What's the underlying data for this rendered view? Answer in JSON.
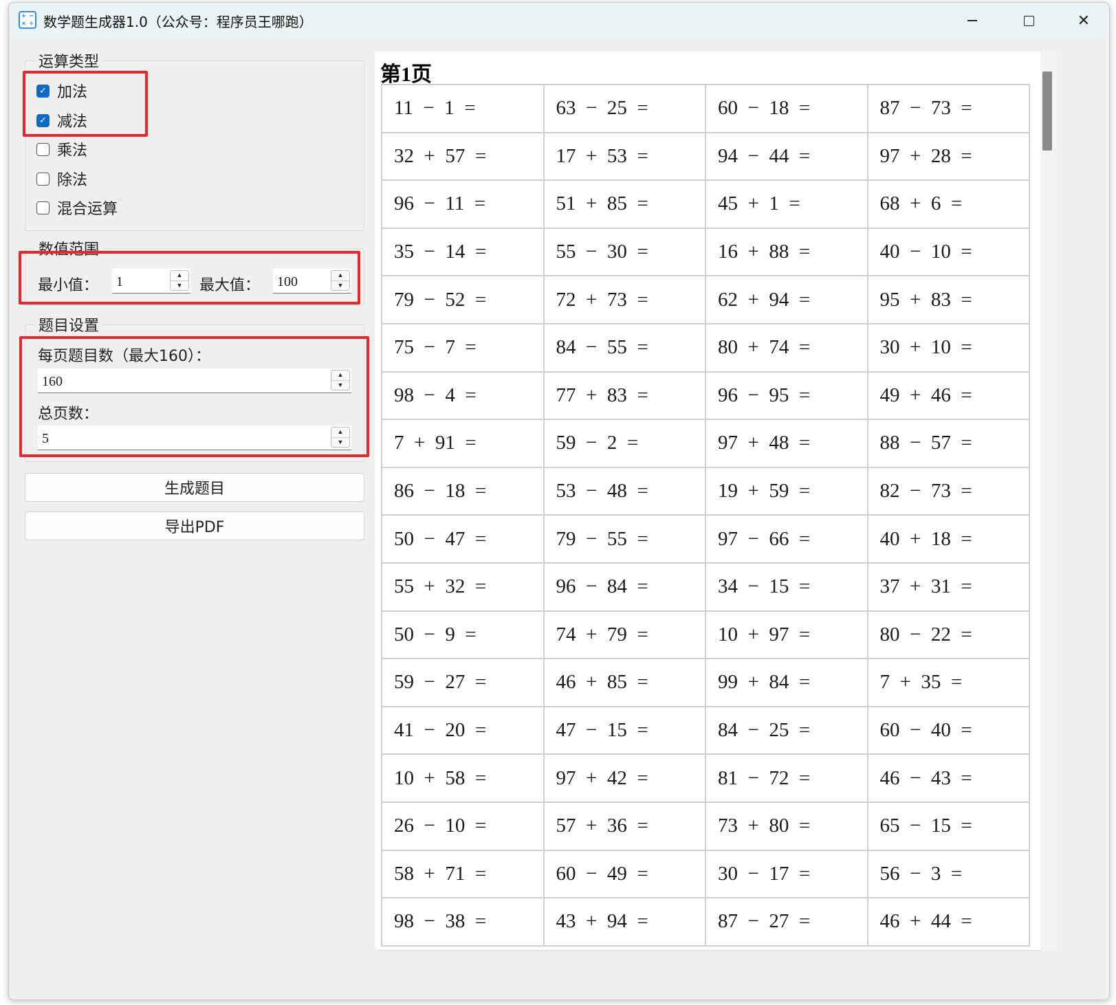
{
  "window": {
    "title": "数学题生成器1.0（公众号：程序员王哪跑）",
    "icon_glyphs": [
      "+",
      "−",
      "×",
      "÷"
    ],
    "minimize_icon": "minimize-icon",
    "maximize_icon": "maximize-icon",
    "close_icon": "close-icon",
    "close_glyph": "✕"
  },
  "operation_group": {
    "title": "运算类型",
    "options": [
      {
        "label": "加法",
        "checked": true
      },
      {
        "label": "减法",
        "checked": true
      },
      {
        "label": "乘法",
        "checked": false
      },
      {
        "label": "除法",
        "checked": false
      },
      {
        "label": "混合运算",
        "checked": false
      }
    ]
  },
  "range_group": {
    "title": "数值范围",
    "min_label": "最小值：",
    "min_value": "1",
    "max_label": "最大值：",
    "max_value": "100"
  },
  "settings_group": {
    "title": "题目设置",
    "per_page_label": "每页题目数（最大160）：",
    "per_page_value": "160",
    "total_pages_label": "总页数：",
    "total_pages_value": "5"
  },
  "buttons": {
    "generate": "生成题目",
    "export_pdf": "导出PDF"
  },
  "highlight_color": "#e8262b",
  "accent_color": "#0d6bc4",
  "preview": {
    "page_title": "第1页",
    "questions": [
      "11  −  1  =",
      "63  −  25  =",
      "60  −  18  =",
      "87  −  73  =",
      "32  +  57  =",
      "17  +  53  =",
      "94  −  44  =",
      "97  +  28  =",
      "96  −  11  =",
      "51  +  85  =",
      "45  +  1  =",
      "68  +  6  =",
      "35  −  14  =",
      "55  −  30  =",
      "16  +  88  =",
      "40  −  10  =",
      "79  −  52  =",
      "72  +  73  =",
      "62  +  94  =",
      "95  +  83  =",
      "75  −  7  =",
      "84  −  55  =",
      "80  +  74  =",
      "30  +  10  =",
      "98  −  4  =",
      "77  +  83  =",
      "96  −  95  =",
      "49  +  46  =",
      "7  +  91  =",
      "59  −  2  =",
      "97  +  48  =",
      "88  −  57  =",
      "86  −  18  =",
      "53  −  48  =",
      "19  +  59  =",
      "82  −  73  =",
      "50  −  47  =",
      "79  −  55  =",
      "97  −  66  =",
      "40  +  18  =",
      "55  +  32  =",
      "96  −  84  =",
      "34  −  15  =",
      "37  +  31  =",
      "50  −  9  =",
      "74  +  79  =",
      "10  +  97  =",
      "80  −  22  =",
      "59  −  27  =",
      "46  +  85  =",
      "99  +  84  =",
      "7  +  35  =",
      "41  −  20  =",
      "47  −  15  =",
      "84  −  25  =",
      "60  −  40  =",
      "10  +  58  =",
      "97  +  42  =",
      "81  −  72  =",
      "46  −  43  =",
      "26  −  10  =",
      "57  +  36  =",
      "73  +  80  =",
      "65  −  15  =",
      "58  +  71  =",
      "60  −  49  =",
      "30  −  17  =",
      "56  −  3  =",
      "98  −  38  =",
      "43  +  94  =",
      "87  −  27  =",
      "46  +  44  ="
    ]
  }
}
